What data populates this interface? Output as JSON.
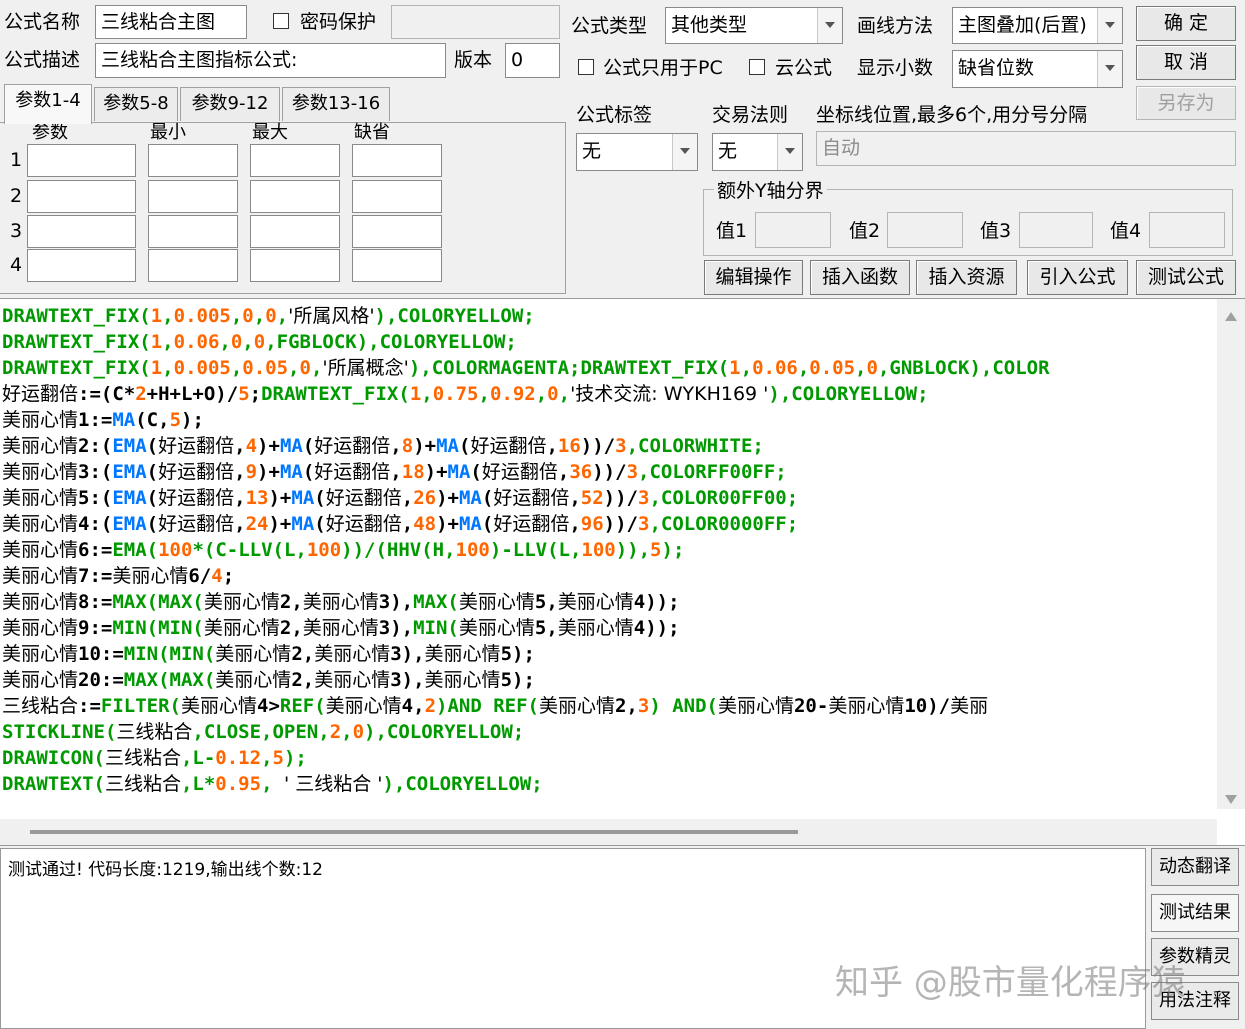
{
  "form": {
    "name_label": "公式名称",
    "name_value": "三线粘合主图",
    "password_label": "密码保护",
    "desc_label": "公式描述",
    "desc_value": "三线粘合主图指标公式:",
    "version_label": "版本",
    "version_value": "0",
    "type_label": "公式类型",
    "type_value": "其他类型",
    "draw_label": "画线方法",
    "draw_value": "主图叠加(后置)",
    "pc_only_label": "公式只用于PC",
    "cloud_label": "云公式",
    "decimals_label": "显示小数",
    "decimals_value": "缺省位数",
    "tag_label": "公式标签",
    "tag_value": "无",
    "trade_label": "交易法则",
    "trade_value": "无",
    "axis_label": "坐标线位置,最多6个,用分号分隔",
    "axis_value": "自动",
    "extra_y_label": "额外Y轴分界",
    "v1": "值1",
    "v2": "值2",
    "v3": "值3",
    "v4": "值4"
  },
  "buttons": {
    "ok": "确  定",
    "cancel": "取  消",
    "save_as": "另存为",
    "edit": "编辑操作",
    "insert_func": "插入函数",
    "insert_res": "插入资源",
    "import": "引入公式",
    "test": "测试公式"
  },
  "tabs": [
    "参数1-4",
    "参数5-8",
    "参数9-12",
    "参数13-16"
  ],
  "param_headers": [
    "参数",
    "最小",
    "最大",
    "缺省"
  ],
  "param_rows": [
    "1",
    "2",
    "3",
    "4"
  ],
  "code_lines": [
    [
      [
        "g",
        "DRAWTEXT_FIX("
      ],
      [
        "n",
        "1"
      ],
      [
        "g",
        ","
      ],
      [
        "n",
        "0.005"
      ],
      [
        "g",
        ","
      ],
      [
        "n",
        "0"
      ],
      [
        "g",
        ","
      ],
      [
        "n",
        "0"
      ],
      [
        "g",
        ","
      ],
      [
        "s",
        "'所属风格'"
      ],
      [
        "g",
        "),COLORYELLOW;"
      ]
    ],
    [
      [
        "g",
        "DRAWTEXT_FIX("
      ],
      [
        "n",
        "1"
      ],
      [
        "g",
        ","
      ],
      [
        "n",
        "0.06"
      ],
      [
        "g",
        ","
      ],
      [
        "n",
        "0"
      ],
      [
        "g",
        ","
      ],
      [
        "n",
        "0"
      ],
      [
        "g",
        ",FGBLOCK),COLORYELLOW;"
      ]
    ],
    [
      [
        "g",
        "DRAWTEXT_FIX("
      ],
      [
        "n",
        "1"
      ],
      [
        "g",
        ","
      ],
      [
        "n",
        "0.005"
      ],
      [
        "g",
        ","
      ],
      [
        "n",
        "0.05"
      ],
      [
        "g",
        ","
      ],
      [
        "n",
        "0"
      ],
      [
        "g",
        ","
      ],
      [
        "s",
        "'所属概念'"
      ],
      [
        "g",
        "),COLORMAGENTA;DRAWTEXT_FIX("
      ],
      [
        "n",
        "1"
      ],
      [
        "g",
        ","
      ],
      [
        "n",
        "0.06"
      ],
      [
        "g",
        ","
      ],
      [
        "n",
        "0.05"
      ],
      [
        "g",
        ","
      ],
      [
        "n",
        "0"
      ],
      [
        "g",
        ",GNBLOCK),COLOR"
      ]
    ],
    [
      [
        "s",
        "好运翻倍"
      ],
      [
        "k",
        ":=(C*"
      ],
      [
        "n",
        "2"
      ],
      [
        "k",
        "+H+L+O)/"
      ],
      [
        "n",
        "5"
      ],
      [
        "k",
        ";"
      ],
      [
        "g",
        "DRAWTEXT_FIX("
      ],
      [
        "n",
        "1"
      ],
      [
        "g",
        ","
      ],
      [
        "n",
        "0.75"
      ],
      [
        "g",
        ","
      ],
      [
        "n",
        "0.92"
      ],
      [
        "g",
        ","
      ],
      [
        "n",
        "0"
      ],
      [
        "g",
        ","
      ],
      [
        "s",
        "'技术交流: WYKH169 '"
      ],
      [
        "g",
        "),COLORYELLOW;"
      ]
    ],
    [
      [
        "s",
        "美丽心情"
      ],
      [
        "k",
        "1:="
      ],
      [
        "b",
        "MA"
      ],
      [
        "k",
        "(C,"
      ],
      [
        "n",
        "5"
      ],
      [
        "k",
        ");"
      ]
    ],
    [
      [
        "s",
        "美丽心情"
      ],
      [
        "k",
        "2:("
      ],
      [
        "b",
        "EMA"
      ],
      [
        "k",
        "("
      ],
      [
        "s",
        "好运翻倍"
      ],
      [
        "k",
        ","
      ],
      [
        "n",
        "4"
      ],
      [
        "k",
        ")+"
      ],
      [
        "b",
        "MA"
      ],
      [
        "k",
        "("
      ],
      [
        "s",
        "好运翻倍"
      ],
      [
        "k",
        ","
      ],
      [
        "n",
        "8"
      ],
      [
        "k",
        ")+"
      ],
      [
        "b",
        "MA"
      ],
      [
        "k",
        "("
      ],
      [
        "s",
        "好运翻倍"
      ],
      [
        "k",
        ","
      ],
      [
        "n",
        "16"
      ],
      [
        "k",
        "))/"
      ],
      [
        "n",
        "3"
      ],
      [
        "g",
        ",COLORWHITE;"
      ]
    ],
    [
      [
        "s",
        "美丽心情"
      ],
      [
        "k",
        "3:("
      ],
      [
        "b",
        "EMA"
      ],
      [
        "k",
        "("
      ],
      [
        "s",
        "好运翻倍"
      ],
      [
        "k",
        ","
      ],
      [
        "n",
        "9"
      ],
      [
        "k",
        ")+"
      ],
      [
        "b",
        "MA"
      ],
      [
        "k",
        "("
      ],
      [
        "s",
        "好运翻倍"
      ],
      [
        "k",
        ","
      ],
      [
        "n",
        "18"
      ],
      [
        "k",
        ")+"
      ],
      [
        "b",
        "MA"
      ],
      [
        "k",
        "("
      ],
      [
        "s",
        "好运翻倍"
      ],
      [
        "k",
        ","
      ],
      [
        "n",
        "36"
      ],
      [
        "k",
        "))/"
      ],
      [
        "n",
        "3"
      ],
      [
        "g",
        ",COLORFF00FF;"
      ]
    ],
    [
      [
        "s",
        "美丽心情"
      ],
      [
        "k",
        "5:("
      ],
      [
        "b",
        "EMA"
      ],
      [
        "k",
        "("
      ],
      [
        "s",
        "好运翻倍"
      ],
      [
        "k",
        ","
      ],
      [
        "n",
        "13"
      ],
      [
        "k",
        ")+"
      ],
      [
        "b",
        "MA"
      ],
      [
        "k",
        "("
      ],
      [
        "s",
        "好运翻倍"
      ],
      [
        "k",
        ","
      ],
      [
        "n",
        "26"
      ],
      [
        "k",
        ")+"
      ],
      [
        "b",
        "MA"
      ],
      [
        "k",
        "("
      ],
      [
        "s",
        "好运翻倍"
      ],
      [
        "k",
        ","
      ],
      [
        "n",
        "52"
      ],
      [
        "k",
        "))/"
      ],
      [
        "n",
        "3"
      ],
      [
        "g",
        ",COLOR00FF00;"
      ]
    ],
    [
      [
        "s",
        "美丽心情"
      ],
      [
        "k",
        "4:("
      ],
      [
        "b",
        "EMA"
      ],
      [
        "k",
        "("
      ],
      [
        "s",
        "好运翻倍"
      ],
      [
        "k",
        ","
      ],
      [
        "n",
        "24"
      ],
      [
        "k",
        ")+"
      ],
      [
        "b",
        "MA"
      ],
      [
        "k",
        "("
      ],
      [
        "s",
        "好运翻倍"
      ],
      [
        "k",
        ","
      ],
      [
        "n",
        "48"
      ],
      [
        "k",
        ")+"
      ],
      [
        "b",
        "MA"
      ],
      [
        "k",
        "("
      ],
      [
        "s",
        "好运翻倍"
      ],
      [
        "k",
        ","
      ],
      [
        "n",
        "96"
      ],
      [
        "k",
        "))/"
      ],
      [
        "n",
        "3"
      ],
      [
        "g",
        ",COLOR0000FF;"
      ]
    ],
    [
      [
        "s",
        "美丽心情"
      ],
      [
        "k",
        "6:="
      ],
      [
        "g",
        "EMA("
      ],
      [
        "n",
        "100"
      ],
      [
        "g",
        "*(C-LLV(L,"
      ],
      [
        "n",
        "100"
      ],
      [
        "g",
        "))/(HHV(H,"
      ],
      [
        "n",
        "100"
      ],
      [
        "g",
        ")-LLV(L,"
      ],
      [
        "n",
        "100"
      ],
      [
        "g",
        ")),"
      ],
      [
        "n",
        "5"
      ],
      [
        "g",
        ");"
      ]
    ],
    [
      [
        "s",
        "美丽心情"
      ],
      [
        "k",
        "7:="
      ],
      [
        "s",
        "美丽心情"
      ],
      [
        "k",
        "6/"
      ],
      [
        "n",
        "4"
      ],
      [
        "k",
        ";"
      ]
    ],
    [
      [
        "s",
        "美丽心情"
      ],
      [
        "k",
        "8:="
      ],
      [
        "g",
        "MAX(MAX("
      ],
      [
        "s",
        "美丽心情"
      ],
      [
        "k",
        "2,"
      ],
      [
        "s",
        "美丽心情"
      ],
      [
        "k",
        "3),"
      ],
      [
        "g",
        "MAX("
      ],
      [
        "s",
        "美丽心情"
      ],
      [
        "k",
        "5,"
      ],
      [
        "s",
        "美丽心情"
      ],
      [
        "k",
        "4));"
      ]
    ],
    [
      [
        "s",
        "美丽心情"
      ],
      [
        "k",
        "9:="
      ],
      [
        "g",
        "MIN(MIN("
      ],
      [
        "s",
        "美丽心情"
      ],
      [
        "k",
        "2,"
      ],
      [
        "s",
        "美丽心情"
      ],
      [
        "k",
        "3),"
      ],
      [
        "g",
        "MIN("
      ],
      [
        "s",
        "美丽心情"
      ],
      [
        "k",
        "5,"
      ],
      [
        "s",
        "美丽心情"
      ],
      [
        "k",
        "4));"
      ]
    ],
    [
      [
        "s",
        "美丽心情"
      ],
      [
        "k",
        "10:="
      ],
      [
        "g",
        "MIN(MIN("
      ],
      [
        "s",
        "美丽心情"
      ],
      [
        "k",
        "2,"
      ],
      [
        "s",
        "美丽心情"
      ],
      [
        "k",
        "3),"
      ],
      [
        "s",
        "美丽心情"
      ],
      [
        "k",
        "5);"
      ]
    ],
    [
      [
        "s",
        "美丽心情"
      ],
      [
        "k",
        "20:="
      ],
      [
        "g",
        "MAX(MAX("
      ],
      [
        "s",
        "美丽心情"
      ],
      [
        "k",
        "2,"
      ],
      [
        "s",
        "美丽心情"
      ],
      [
        "k",
        "3),"
      ],
      [
        "s",
        "美丽心情"
      ],
      [
        "k",
        "5);"
      ]
    ],
    [
      [
        "s",
        "三线粘合"
      ],
      [
        "k",
        ":="
      ],
      [
        "g",
        "FILTER("
      ],
      [
        "s",
        "美丽心情"
      ],
      [
        "k",
        "4>"
      ],
      [
        "g",
        "REF("
      ],
      [
        "s",
        "美丽心情"
      ],
      [
        "k",
        "4,"
      ],
      [
        "n",
        "2"
      ],
      [
        "g",
        ")AND REF("
      ],
      [
        "s",
        "美丽心情"
      ],
      [
        "k",
        "2,"
      ],
      [
        "n",
        "3"
      ],
      [
        "g",
        ") AND("
      ],
      [
        "s",
        "美丽心情"
      ],
      [
        "k",
        "20-"
      ],
      [
        "s",
        "美丽心情"
      ],
      [
        "k",
        "10)/"
      ],
      [
        "s",
        "美丽"
      ]
    ],
    [
      [
        "g",
        "STICKLINE("
      ],
      [
        "s",
        "三线粘合"
      ],
      [
        "g",
        ",CLOSE,OPEN,"
      ],
      [
        "n",
        "2"
      ],
      [
        "g",
        ","
      ],
      [
        "n",
        "0"
      ],
      [
        "g",
        "),COLORYELLOW;"
      ]
    ],
    [
      [
        "g",
        "DRAWICON("
      ],
      [
        "s",
        "三线粘合"
      ],
      [
        "g",
        ",L-"
      ],
      [
        "n",
        "0.12"
      ],
      [
        "g",
        ","
      ],
      [
        "n",
        "5"
      ],
      [
        "g",
        ");"
      ]
    ],
    [
      [
        "g",
        "DRAWTEXT("
      ],
      [
        "s",
        "三线粘合"
      ],
      [
        "g",
        ",L*"
      ],
      [
        "n",
        "0.95"
      ],
      [
        "g",
        ", "
      ],
      [
        "s",
        "' 三线粘合 '"
      ],
      [
        "g",
        "),COLORYELLOW;"
      ]
    ]
  ],
  "output_text": "测试通过! 代码长度:1219,输出线个数:12",
  "side_buttons": [
    "动态翻译",
    "测试结果",
    "参数精灵",
    "用法注释"
  ],
  "watermark": "知乎 @股市量化程序猿"
}
